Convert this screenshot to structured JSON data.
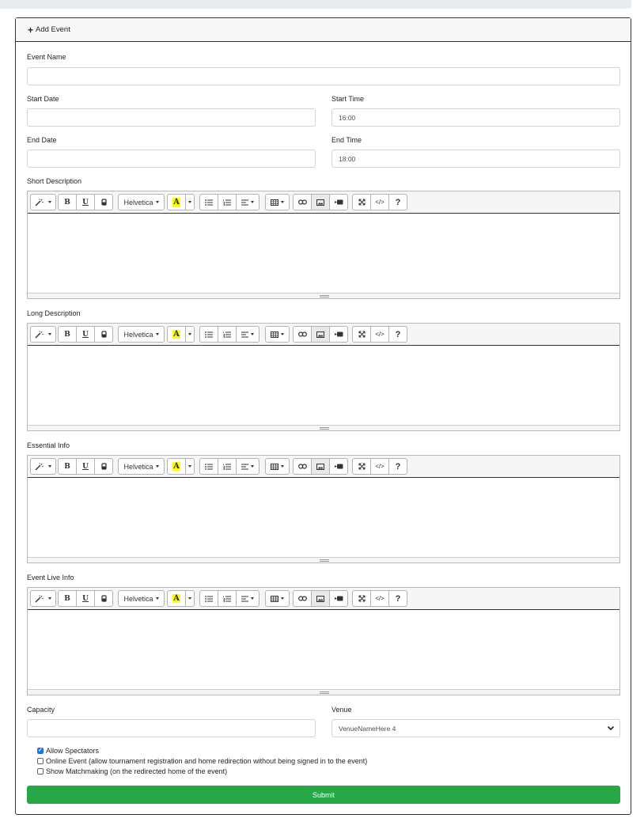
{
  "header": {
    "add_event_label": "Add Event"
  },
  "fields": {
    "event_name": {
      "label": "Event Name",
      "value": ""
    },
    "start_date": {
      "label": "Start Date",
      "value": ""
    },
    "start_time": {
      "label": "Start Time",
      "value": "16:00"
    },
    "end_date": {
      "label": "End Date",
      "value": ""
    },
    "end_time": {
      "label": "End Time",
      "value": "18:00"
    },
    "capacity": {
      "label": "Capacity",
      "value": ""
    },
    "venue": {
      "label": "Venue",
      "value": "VenueNameHere 4"
    }
  },
  "editors": [
    {
      "label": "Short Description"
    },
    {
      "label": "Long Description"
    },
    {
      "label": "Essential Info"
    },
    {
      "label": "Event Live Info"
    }
  ],
  "toolbar": {
    "font_name": "Helvetica",
    "bold": "B",
    "underline": "U",
    "color": "A",
    "code": "</>",
    "help": "?",
    "icons": [
      "magic-icon",
      "bold-icon",
      "underline-icon",
      "eraser-icon",
      "font-icon",
      "color-icon",
      "ul-icon",
      "ol-icon",
      "align-icon",
      "table-icon",
      "link-icon",
      "picture-icon",
      "video-icon",
      "fullscreen-icon",
      "codeview-icon",
      "help-icon"
    ]
  },
  "checkboxes": [
    {
      "label": "Allow Spectators",
      "checked": true
    },
    {
      "label": "Online Event (allow tournament registration and home redirection without being signed in to the event)",
      "checked": false
    },
    {
      "label": "Show Matchmaking (on the redirected home of the event)",
      "checked": false
    }
  ],
  "submit_label": "Submit",
  "colors": {
    "submit": "#28a745",
    "checkbox": "#1a73e8",
    "highlight": "#ffff00"
  }
}
